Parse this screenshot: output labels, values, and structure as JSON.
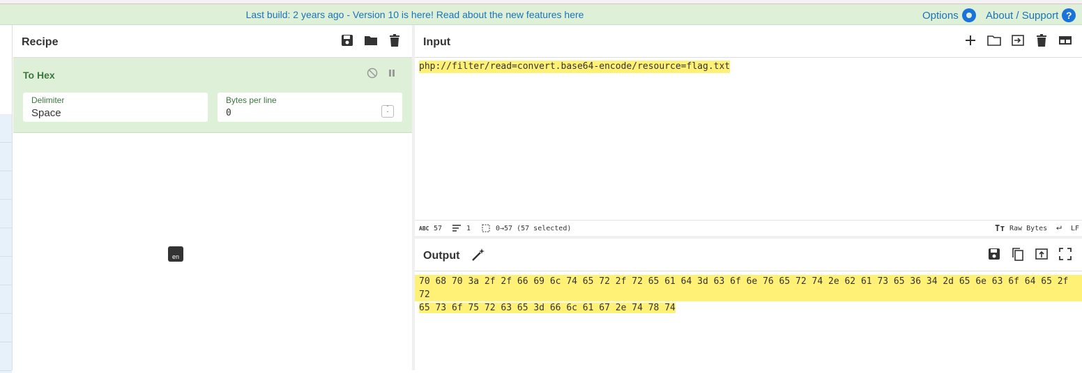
{
  "banner": {
    "message": "Last build: 2 years ago - Version 10 is here! Read about the new features here",
    "options_label": "Options",
    "about_label": "About / Support",
    "help_glyph": "?"
  },
  "recipe": {
    "title": "Recipe",
    "operation": {
      "name": "To Hex",
      "delimiter_label": "Delimiter",
      "delimiter_value": "Space",
      "bytes_label": "Bytes per line",
      "bytes_value": "0"
    },
    "magic_label": "en"
  },
  "input": {
    "title": "Input",
    "text": "php://filter/read=convert.base64-encode/resource=flag.txt",
    "status": {
      "chars_icon": "abc-icon",
      "chars": "57",
      "lines": "1",
      "selection": "0→57 (57 selected)",
      "encoding": "Raw Bytes",
      "eol": "LF"
    }
  },
  "output": {
    "title": "Output",
    "lines": [
      "70 68 70 3a 2f 2f 66 69 6c 74 65 72 2f 72 65 61 64 3d 63 6f 6e 76 65 72 74 2e 62 61 73 65 36 34 2d 65 6e 63 6f 64 65 2f 72",
      "65 73 6f 75 72 63 65 3d 66 6c 61 67 2e 74 78 74"
    ]
  },
  "colors": {
    "banner_bg": "#dff0d8",
    "link": "#1a73b8",
    "op_bg": "#dff0d8",
    "highlight": "#fff176"
  }
}
